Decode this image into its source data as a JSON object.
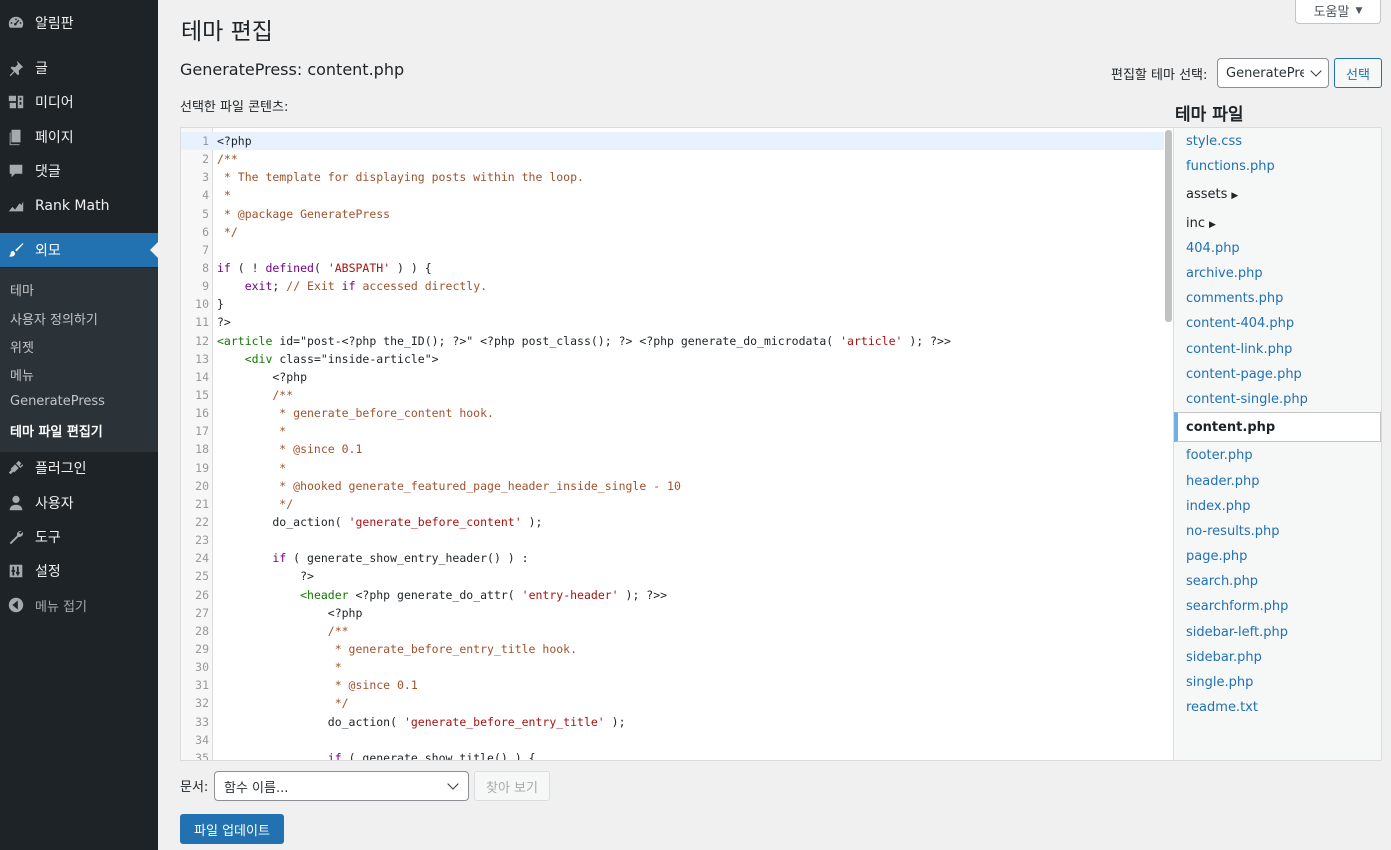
{
  "sidebar": {
    "items": [
      {
        "label": "알림판",
        "icon": "dashboard-icon"
      },
      {
        "label": "글",
        "icon": "pin-icon"
      },
      {
        "label": "미디어",
        "icon": "media-icon"
      },
      {
        "label": "페이지",
        "icon": "page-icon"
      },
      {
        "label": "댓글",
        "icon": "comment-icon"
      },
      {
        "label": "Rank Math",
        "icon": "rank-math-icon"
      },
      {
        "label": "외모",
        "icon": "appearance-brush-icon"
      },
      {
        "label": "플러그인",
        "icon": "plugin-icon"
      },
      {
        "label": "사용자",
        "icon": "user-icon"
      },
      {
        "label": "도구",
        "icon": "wrench-icon"
      },
      {
        "label": "설정",
        "icon": "settings-icon"
      },
      {
        "label": "메뉴 접기",
        "icon": "collapse-icon"
      }
    ],
    "submenu": [
      "테마",
      "사용자 정의하기",
      "위젯",
      "메뉴",
      "GeneratePress",
      "테마 파일 편집기"
    ]
  },
  "header": {
    "help": "도움말",
    "page_title": "테마 편집",
    "file_title": "GeneratePress: content.php",
    "select_label": "편집할 테마 선택:",
    "selected_theme": "GeneratePress",
    "select_button": "선택",
    "content_label": "선택한 파일 콘텐츠:"
  },
  "editor": {
    "lines": [
      "<?php",
      "/**",
      " * The template for displaying posts within the loop.",
      " *",
      " * @package GeneratePress",
      " */",
      "",
      "if ( ! defined( 'ABSPATH' ) ) {",
      "    exit; // Exit if accessed directly.",
      "}",
      "?>",
      "<article id=\"post-<?php the_ID(); ?>\" <?php post_class(); ?> <?php generate_do_microdata( 'article' ); ?>>",
      "    <div class=\"inside-article\">",
      "        <?php",
      "        /**",
      "         * generate_before_content hook.",
      "         *",
      "         * @since 0.1",
      "         *",
      "         * @hooked generate_featured_page_header_inside_single - 10",
      "         */",
      "        do_action( 'generate_before_content' );",
      "",
      "        if ( generate_show_entry_header() ) :",
      "            ?>",
      "            <header <?php generate_do_attr( 'entry-header' ); ?>>",
      "                <?php",
      "                /**",
      "                 * generate_before_entry_title hook.",
      "                 *",
      "                 * @since 0.1",
      "                 */",
      "                do_action( 'generate_before_entry_title' );",
      "",
      "                if ( generate_show_title() ) {"
    ]
  },
  "files": {
    "heading": "테마 파일",
    "items": [
      {
        "name": "style.css",
        "type": "file"
      },
      {
        "name": "functions.php",
        "type": "file"
      },
      {
        "name": "assets",
        "type": "dir"
      },
      {
        "name": "inc",
        "type": "dir"
      },
      {
        "name": "404.php",
        "type": "file"
      },
      {
        "name": "archive.php",
        "type": "file"
      },
      {
        "name": "comments.php",
        "type": "file"
      },
      {
        "name": "content-404.php",
        "type": "file"
      },
      {
        "name": "content-link.php",
        "type": "file"
      },
      {
        "name": "content-page.php",
        "type": "file"
      },
      {
        "name": "content-single.php",
        "type": "file"
      },
      {
        "name": "content.php",
        "type": "current"
      },
      {
        "name": "footer.php",
        "type": "file"
      },
      {
        "name": "header.php",
        "type": "file"
      },
      {
        "name": "index.php",
        "type": "file"
      },
      {
        "name": "no-results.php",
        "type": "file"
      },
      {
        "name": "page.php",
        "type": "file"
      },
      {
        "name": "search.php",
        "type": "file"
      },
      {
        "name": "searchform.php",
        "type": "file"
      },
      {
        "name": "sidebar-left.php",
        "type": "file"
      },
      {
        "name": "sidebar.php",
        "type": "file"
      },
      {
        "name": "single.php",
        "type": "file"
      },
      {
        "name": "readme.txt",
        "type": "file"
      }
    ]
  },
  "bottom": {
    "doc_label": "문서:",
    "doc_placeholder": "함수 이름...",
    "lookup_button": "찾아 보기",
    "update_button": "파일 업데이트"
  },
  "colors": {
    "sidebar_bg": "#1d2327",
    "accent": "#2271b1",
    "link": "#2271b1"
  }
}
